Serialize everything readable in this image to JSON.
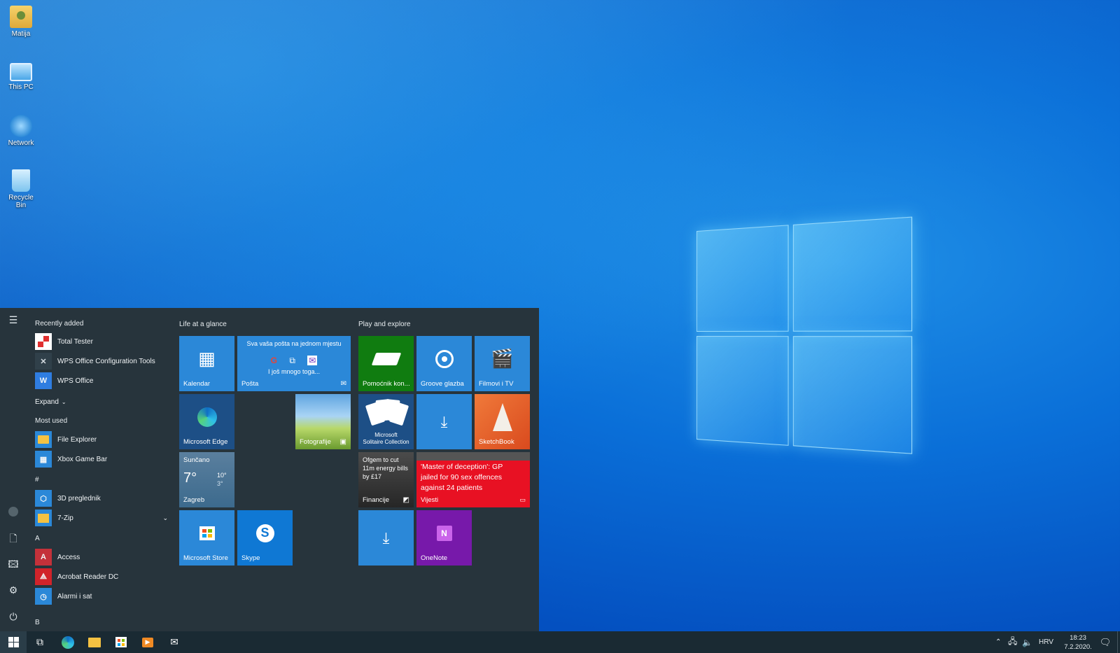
{
  "desktop": {
    "icons": [
      {
        "label": "Matija",
        "icon": "user-folder-icon"
      },
      {
        "label": "This PC",
        "icon": "computer-icon"
      },
      {
        "label": "Network",
        "icon": "network-icon"
      },
      {
        "label": "Recycle Bin",
        "icon": "recycle-bin-icon"
      }
    ]
  },
  "start_menu": {
    "recently_added": {
      "header": "Recently added",
      "items": [
        {
          "label": "Total Tester",
          "color": "#e02f2f"
        },
        {
          "label": "WPS Office Configuration Tools",
          "color": "#30404a"
        },
        {
          "label": "WPS Office",
          "color": "#2f7de1"
        }
      ],
      "expand_label": "Expand"
    },
    "most_used": {
      "header": "Most used",
      "items": [
        {
          "label": "File Explorer",
          "color": "#f5c242"
        },
        {
          "label": "Xbox Game Bar",
          "color": "#2b88d8"
        }
      ]
    },
    "alpha_sections": [
      {
        "letter": "#",
        "items": [
          {
            "label": "3D preglednik",
            "color": "#2b88d8"
          },
          {
            "label": "7-Zip",
            "color": "#f5c242"
          }
        ]
      },
      {
        "letter": "A",
        "items": [
          {
            "label": "Access",
            "color": "#c4313a"
          },
          {
            "label": "Acrobat Reader DC",
            "color": "#d1232a"
          },
          {
            "label": "Alarmi i sat",
            "color": "#2b88d8"
          }
        ]
      },
      {
        "letter": "B",
        "items": []
      }
    ],
    "groups": [
      {
        "name": "Life at a glance"
      },
      {
        "name": "Play and explore"
      }
    ],
    "tiles": {
      "kalendar": "Kalendar",
      "posta": "Pošta",
      "posta_header": "Sva vaša pošta na jednom mjestu",
      "posta_more": "I još mnogo toga...",
      "edge": "Microsoft Edge",
      "fotografije": "Fotografije",
      "weather_cond": "Sunčano",
      "weather_temp": "7°",
      "weather_high": "10°",
      "weather_low": "3°",
      "weather_city": "Zagreb",
      "store": "Microsoft Store",
      "skype": "Skype",
      "pomocnik": "Pomoćnik kon...",
      "groove": "Groove glazba",
      "filmovi": "Filmovi i TV",
      "solitaire_line1": "Microsoft",
      "solitaire_line2": "Solitaire Collection",
      "sketchbook": "SketchBook",
      "finance_headline": "Ofgem to cut 11m energy bills by £17",
      "finance_label": "Financije",
      "news_headline": "'Master of deception': GP jailed for 90 sex offences against 24 patients",
      "news_label": "Vijesti",
      "onenote": "OneNote"
    }
  },
  "taskbar": {
    "language": "HRV",
    "time": "18:23",
    "date": "7.2.2020."
  }
}
